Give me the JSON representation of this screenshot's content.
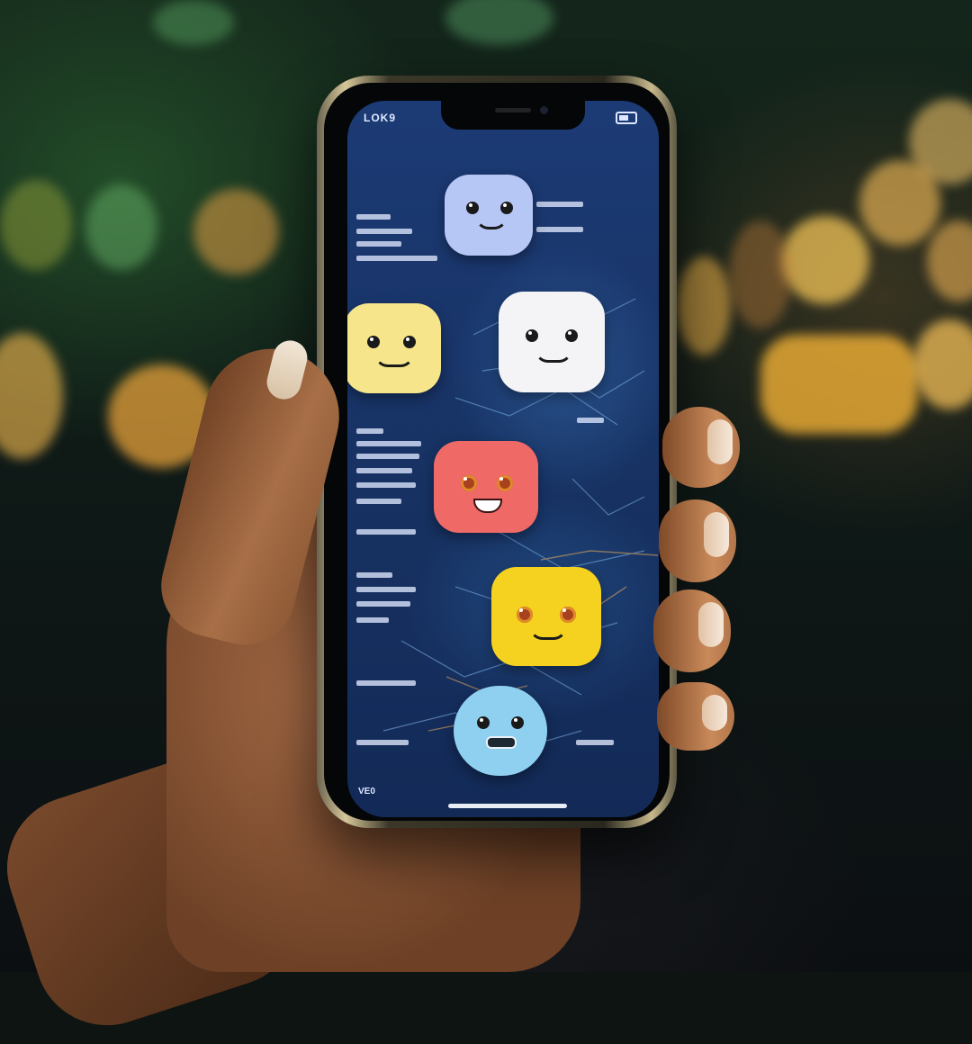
{
  "scene": {
    "background_colors": [
      "#14261b",
      "#0f1a17",
      "#0c0f12"
    ],
    "bokeh_colors": [
      "#f5b64a",
      "#ffd470",
      "#74c66d",
      "#e6a23a"
    ]
  },
  "phone": {
    "frame_color": "#d6c79a",
    "screen_color": "#1c3a75",
    "status_left": "LOK9"
  },
  "emojis": [
    {
      "name": "light-blue",
      "color": "#b7c7f5",
      "expression": "smile"
    },
    {
      "name": "pale-yellow",
      "color": "#f6e58a",
      "expression": "smile"
    },
    {
      "name": "white",
      "color": "#f4f4f6",
      "expression": "smile"
    },
    {
      "name": "coral-red",
      "color": "#ef6a66",
      "expression": "grin"
    },
    {
      "name": "yellow",
      "color": "#f5d21f",
      "expression": "smile"
    },
    {
      "name": "sky-blue",
      "color": "#8fd0f0",
      "expression": "frown"
    }
  ],
  "bottom_left_label": "VE0"
}
